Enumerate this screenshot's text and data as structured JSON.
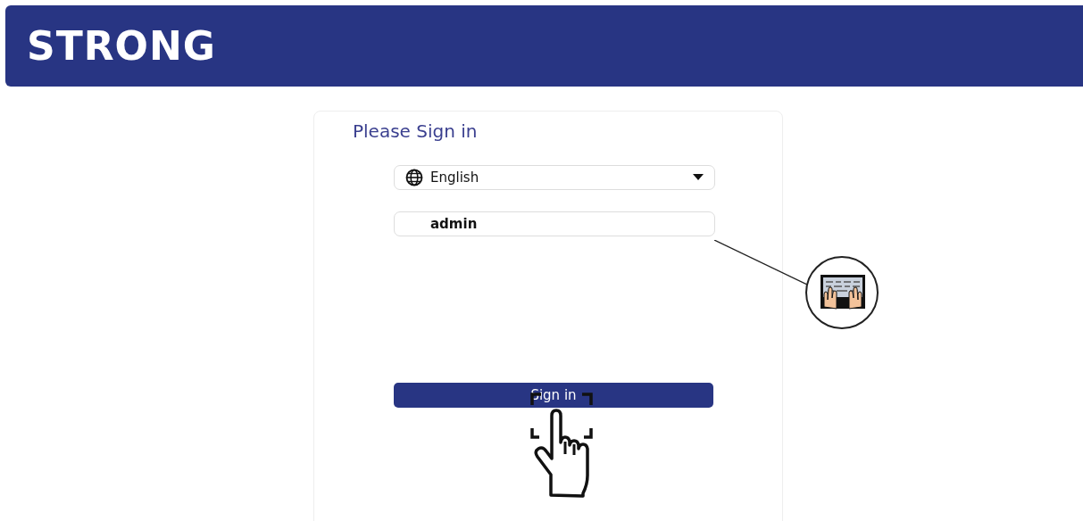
{
  "header": {
    "logo": "STRONG"
  },
  "login": {
    "title": "Please Sign in",
    "language": {
      "value": "English"
    },
    "username": {
      "value": "admin"
    },
    "submit": "Sign in"
  }
}
